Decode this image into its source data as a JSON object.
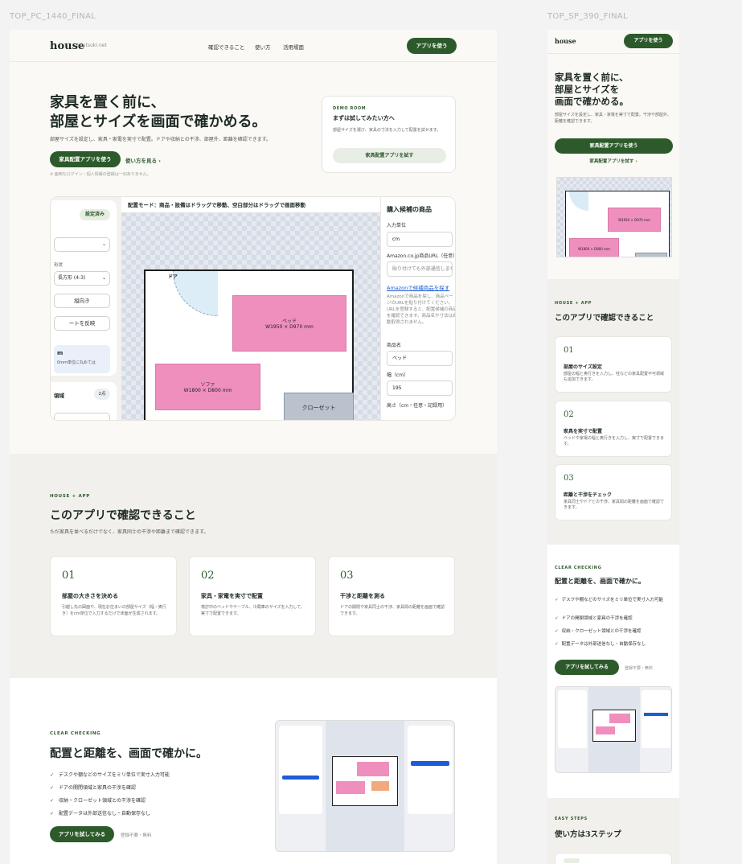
{
  "frames": {
    "pc": "TOP_PC_1440_FINAL",
    "sp": "TOP_SP_390_FINAL"
  },
  "brand": {
    "name": "house",
    "sub": "kyutsuki.net",
    "accent": "#2d5a2b"
  },
  "nav": [
    "確認できること",
    "使い方",
    "活用場面"
  ],
  "header": {
    "cta": "アプリを使う"
  },
  "hero": {
    "title_1": "家具を置く前に、",
    "title_2": "部屋とサイズを画面で確かめる。",
    "description": "部屋サイズを設定し、家具・家電を実寸で配置。ドアや収納との干渉、部屋外、距離を確認できます。",
    "cta": "家具配置アプリを使う",
    "link": "使い方を見る",
    "note": "※ 面倒なログイン・個人情報の登録は一切ありません。"
  },
  "demo": {
    "tag": "DEMO ROOM",
    "title": "まずは試してみたい方へ",
    "description": "部屋サイズを選び、家具の寸法を入力して配置を試せます。",
    "cta": "家具配置アプリを試す"
  },
  "app": {
    "left": {
      "badge": "設定済み",
      "shape_label": "形状",
      "shape_value": "長方形 (4:3)",
      "orientation": "縦向き",
      "flip": "ートを反映",
      "info_title": "m",
      "info_desc": "0mm単位に丸めては",
      "area_label": "領域",
      "area_count": "2点"
    },
    "canvas_bar": "配置モード：商品・設備はドラッグで移動、空白部分はドラッグで画面移動",
    "door": "ドア",
    "bed": {
      "name": "ベッド",
      "size": "W1950 × D970 mm"
    },
    "sofa": {
      "name": "ソファ",
      "size": "W1800 × D800 mm"
    },
    "closet": "クローゼット",
    "right": {
      "title": "購入候補の商品",
      "unit_label": "入力単位",
      "unit_value": "cm",
      "url_label": "Amazon.co.jp商品URL（任意）",
      "url_placeholder": "貼り付けても外部通信しません",
      "link": "Amazonで候補商品を探す",
      "note": "Amazonで商品を探し、商品ページのURLを貼り付けてください。URLを登録すると、配置候補の商品を確認できます。商品名や寸法は自動取得されません。",
      "name_label": "商品名",
      "name_value": "ベッド",
      "width_label": "幅（cm）",
      "width_value": "195",
      "height_label": "高さ（cm・任意・記録用）"
    }
  },
  "features": {
    "tag": "HOUSE + APP",
    "title": "このアプリで確認できること",
    "description": "ただ家具を並べるだけでなく、家具同士の干渉や距離まで確認できます。",
    "items": [
      {
        "num": "01",
        "title": "部屋の大きさを決める",
        "desc": "引越し先の図面や、現在お住まいの部屋サイズ（幅・奥行き）をcm単位で入力するだけで床面が生成されます。"
      },
      {
        "num": "02",
        "title": "家具・家電を実寸で配置",
        "desc": "検討中のベッドやテーブル、冷蔵庫のサイズを入力して、実寸で配置できます。"
      },
      {
        "num": "03",
        "title": "干渉と距離を測る",
        "desc": "ドアの開閉や家具同士の干渉、家具間の距離を画面で確認できます。"
      }
    ]
  },
  "checking": {
    "tag": "CLEAR CHECKING",
    "title": "配置と距離を、画面で確かに。",
    "items": [
      "デスクや棚などのサイズをミリ単位で実寸入力可能",
      "ドアの開閉領域と家具の干渉を確認",
      "収納・クローゼット領域との干渉を確認",
      "配置データは外部送信なし・自動保存なし"
    ],
    "cta": "アプリを試してみる",
    "note": "登録不要・無料"
  },
  "sp": {
    "title_1": "家具を置く前に、",
    "title_2": "部屋とサイズを",
    "title_3": "画面で確かめる。",
    "description": "部屋サイズを設定し、家具・家電を実寸で配置。干渉や部屋外、距離を確認できます。",
    "cta": "家具配置アプリを使う",
    "link": "家具配置アプリを試す",
    "bed": "W1950 × D970 mm",
    "sofa": "W1800 × D800 mm",
    "features": [
      {
        "num": "01",
        "title": "部屋のサイズ設定",
        "desc": "部屋の幅と奥行きを入力し、柱などの家具配置不可領域も追加できます。"
      },
      {
        "num": "02",
        "title": "家具を実寸で配置",
        "desc": "ベッドや家電の幅と奥行きを入力し、実寸で配置できます。"
      },
      {
        "num": "03",
        "title": "距離と干渉をチェック",
        "desc": "家具同士やドアとの干渉、家具間の距離を画面で確認できます。"
      }
    ],
    "steps_tag": "EASY STEPS",
    "steps_title": "使い方は3ステップ"
  }
}
